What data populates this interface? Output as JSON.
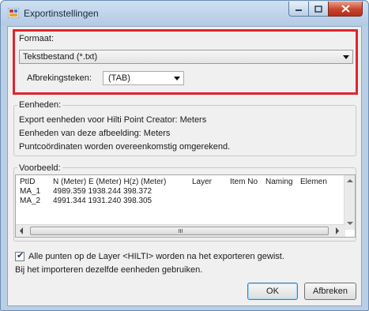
{
  "window": {
    "title": "Exportinstellingen"
  },
  "format": {
    "label": "Formaat:",
    "selected": "Tekstbestand (*.txt)",
    "separator_label": "Afbrekingsteken:",
    "separator_value": "(TAB)"
  },
  "units": {
    "label": "Eenheden:",
    "lines": [
      "Export eenheden voor Hilti Point Creator: Meters",
      "Eenheden van deze afbeelding: Meters",
      "Puntcoördinaten worden overeenkomstig omgerekend."
    ]
  },
  "preview": {
    "label": "Voorbeeld:",
    "columns": [
      "PtID",
      "N (Meter) E (Meter) H(z) (Meter)",
      "Layer",
      "Item No",
      "Naming",
      "Elemen"
    ],
    "rows": [
      {
        "id": "MA_1",
        "values": "4989.359 1938.244 398.372"
      },
      {
        "id": "MA_2",
        "values": "4991.344 1931.240 398.305"
      }
    ]
  },
  "checkbox": {
    "label": "Alle punten op de Layer <HILTI> worden na het exporteren gewist.",
    "checked": true
  },
  "note": "Bij het importeren dezelfde eenheden gebruiken.",
  "buttons": {
    "ok": "OK",
    "cancel": "Afbreken"
  },
  "colors": {
    "highlight": "#e0252d",
    "titlebar": "#b9cfe6",
    "close": "#c8442a"
  }
}
